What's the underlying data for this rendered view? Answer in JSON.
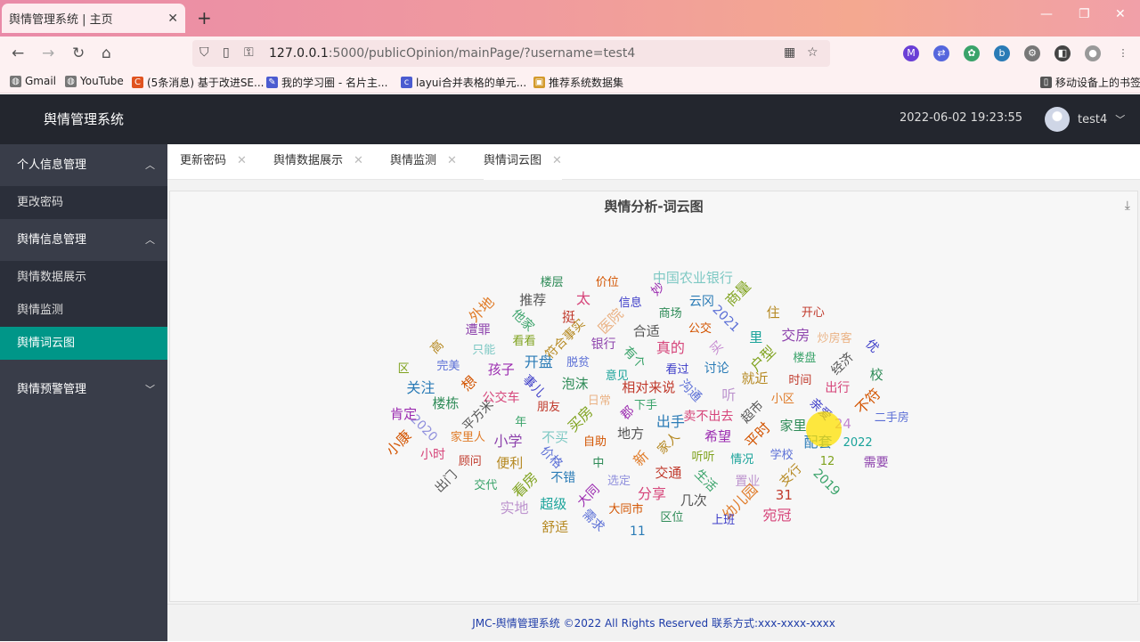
{
  "browser": {
    "tab_title": "舆情管理系统 | 主页",
    "tab_close": "✕",
    "new_tab": "+",
    "url_host": "127.0.0.1",
    "url_path": ":5000/publicOpinion/mainPage/?username=test4",
    "bookmarks": [
      "Gmail",
      "YouTube",
      "(5条消息) 基于改进SE...",
      "我的学习圈 - 名片主...",
      "layui合并表格的单元...",
      "推荐系统数据集"
    ],
    "mobile_bookmarks": "移动设备上的书签",
    "ext_labels": [
      "M"
    ]
  },
  "app": {
    "brand": "舆情管理系统",
    "datetime": "2022-06-02 19:23:55",
    "username": "test4",
    "sidebar": {
      "groups": [
        {
          "label": "个人信息管理",
          "items": [
            "更改密码"
          ]
        },
        {
          "label": "舆情信息管理",
          "items": [
            "舆情数据展示",
            "舆情监测",
            "舆情词云图"
          ]
        },
        {
          "label": "舆情预警管理",
          "items": []
        }
      ]
    },
    "tabs": [
      "更新密码",
      "舆情数据展示",
      "舆情监测",
      "舆情词云图"
    ],
    "chart_title": "舆情分析-词云图",
    "footer": "JMC-舆情管理系统 ©2022 All Rights Reserved 联系方式:xxx-xxxx-xxxx"
  },
  "chart_data": {
    "type": "wordcloud",
    "title": "舆情分析-词云图",
    "words": [
      "下手",
      "郡",
      "相对来说",
      "出手",
      "日常",
      "沟通",
      "地方",
      "意见",
      "卖不出去",
      "买房",
      "看过",
      "家人",
      "泡沫",
      "听",
      "自助",
      "有个",
      "希望",
      "朋友",
      "讨论",
      "新",
      "脱贫",
      "超市",
      "不买",
      "真的",
      "听听",
      "事儿",
      "就近",
      "中",
      "银行",
      "平时",
      "年",
      "买",
      "交通",
      "开盘",
      "小区",
      "价格",
      "合适",
      "情况",
      "公交车",
      "户型",
      "选定",
      "符合事实",
      "家里",
      "小学",
      "公交",
      "生活",
      "孩子",
      "时间",
      "不错",
      "医院",
      "学校",
      "平方米",
      "里",
      "分享",
      "看看",
      "亲爱",
      "便利",
      "商场",
      "置业",
      "想",
      "楼盘",
      "大同",
      "挺",
      "配套",
      "家里人",
      "2021",
      "几次",
      "只能",
      "出行",
      "看房",
      "信息",
      "支行",
      "楼栋",
      "交房",
      "大同市",
      "他家",
      "24",
      "顾问",
      "云冈",
      "幼儿园",
      "完美",
      "经济",
      "超级",
      "太",
      "12",
      "2020",
      "住",
      "区位",
      "遭罪",
      "不符",
      "交代",
      "妙",
      "31",
      "关注",
      "炒房客",
      "需求",
      "推荐",
      "2022",
      "小时",
      "商量",
      "上班",
      "高",
      "校",
      "实地",
      "价位",
      "2019",
      "肯定",
      "开心",
      "11",
      "外地",
      "二手房",
      "出门",
      "中国农业银行",
      "宛冠",
      "区",
      "优",
      "舒适",
      "楼层",
      "需要",
      "小康"
    ],
    "colors": [
      "#3aa36a",
      "#9b2bb0",
      "#c0392b",
      "#2a7bb6",
      "#e07b28",
      "#5b6fd6",
      "#555555",
      "#1aa39a",
      "#d6457a",
      "#7fa21e",
      "#3c3cc8",
      "#b58820",
      "#2e8b57",
      "#8e44ad",
      "#d35400"
    ]
  }
}
